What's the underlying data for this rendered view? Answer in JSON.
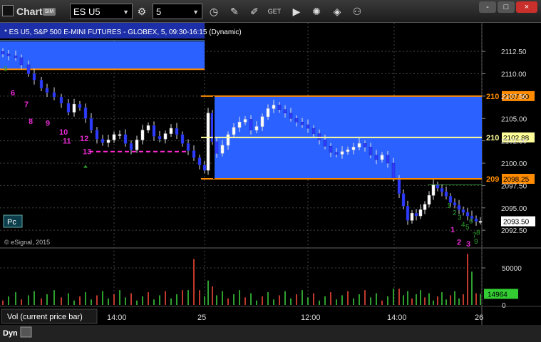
{
  "toolbar": {
    "title": "Chart",
    "badge": "SIM",
    "symbol": "ES U5",
    "interval": "5",
    "tools": [
      "clock-link-icon",
      "clock-icon",
      "pencil-icon",
      "pen-icon",
      "get-icon",
      "play-icon",
      "gear-icon",
      "ruler-icon",
      "people-icon"
    ],
    "window_buttons": [
      "-",
      "□",
      "×"
    ]
  },
  "chart_data": {
    "type": "candlestick",
    "title": "* ES U5, S&P 500 E-MINI FUTURES - GLOBEX, 5, 09:30-16:15 (Dynamic)",
    "watermark": "© eSignal, 2015",
    "pc_label": "Pc",
    "y_ticks": [
      "2112.50",
      "2110.00",
      "2107.50",
      "2105.00",
      "2102.50",
      "2100.00",
      "2097.50",
      "2095.00",
      "2092.50"
    ],
    "x_ticks": [
      "14:00",
      "25",
      "12:00",
      "14:00",
      "26"
    ],
    "price_range": [
      2090.6,
      2114.9
    ],
    "levels": [
      {
        "label": "2107.50",
        "price": 2107.5,
        "color": "#ff8c00"
      },
      {
        "label": "2102.88",
        "price": 2102.88,
        "color": "#ffff99"
      },
      {
        "label": "2098.25",
        "price": 2098.25,
        "color": "#ff8c00"
      }
    ],
    "level_prefixes": [
      "210",
      "210",
      "209"
    ],
    "last_price_label": "2093.50",
    "last_price": 2093.5,
    "td_counts_magenta": [
      "6",
      "7",
      "8",
      "9",
      "10",
      "11",
      "12",
      "13",
      "1",
      "2",
      "3"
    ],
    "td_counts_green": [
      "9",
      "1",
      "2",
      "3",
      "4",
      "5",
      "6",
      "7",
      "8",
      "9"
    ],
    "volume": {
      "title": "Vol (current price bar)",
      "y_ticks": [
        "50000",
        "0"
      ],
      "current_label": "14964",
      "current_value": 14964,
      "range": [
        0,
        75000
      ]
    },
    "bottom_label": "Dyn"
  }
}
